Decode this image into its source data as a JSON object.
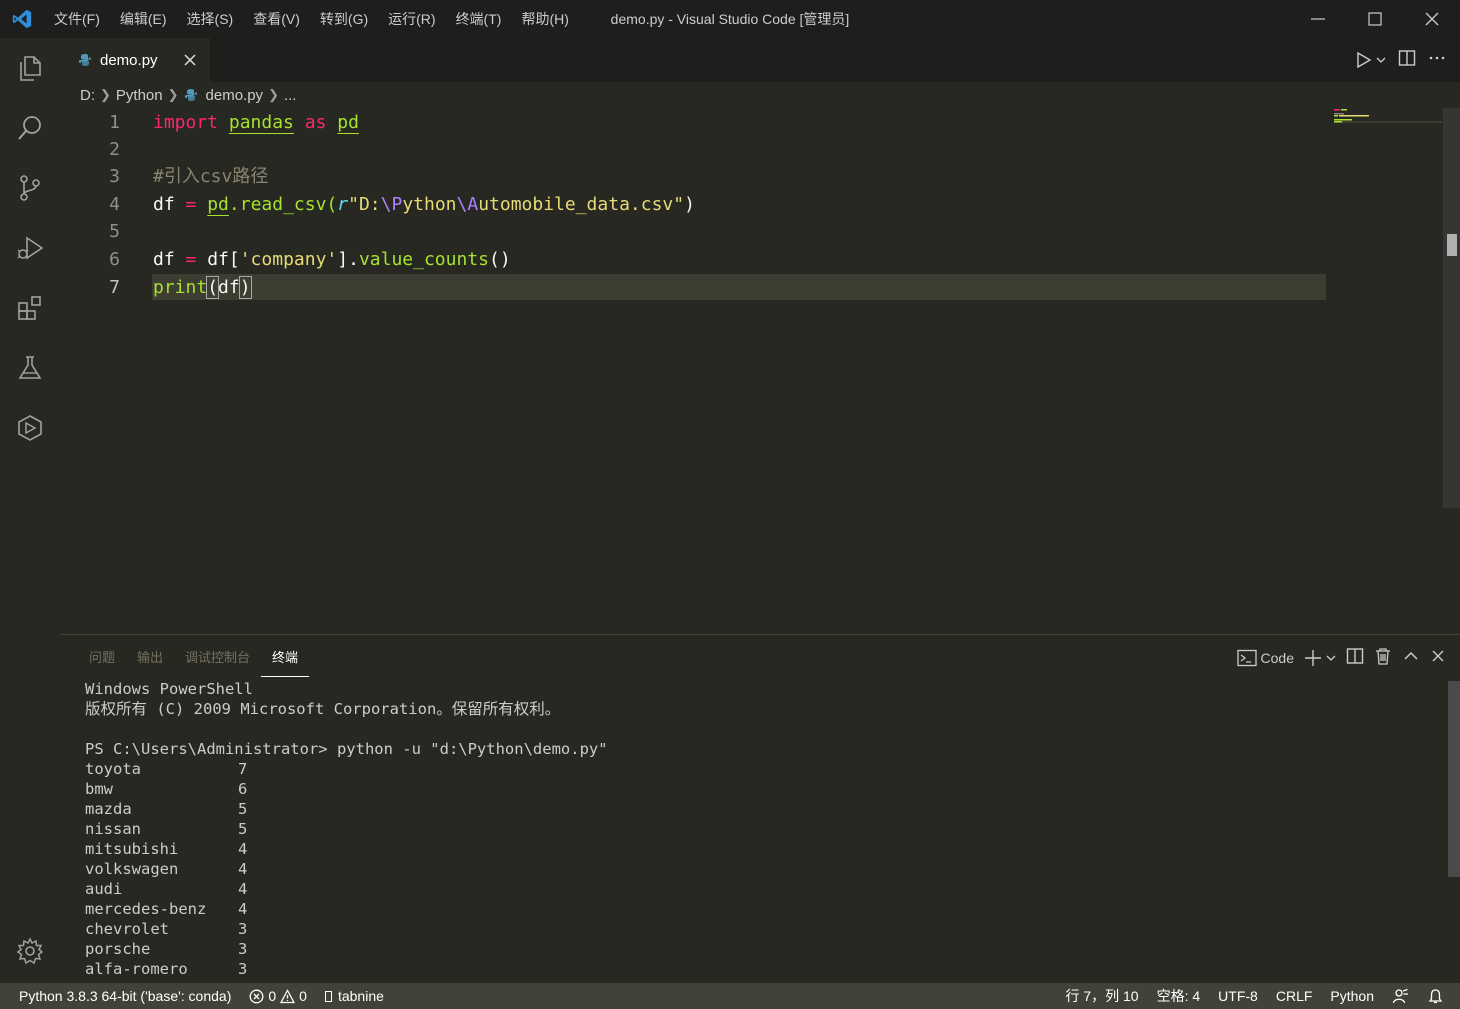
{
  "window": {
    "title": "demo.py - Visual Studio Code [管理员]"
  },
  "menu": [
    "文件(F)",
    "编辑(E)",
    "选择(S)",
    "查看(V)",
    "转到(G)",
    "运行(R)",
    "终端(T)",
    "帮助(H)"
  ],
  "tab": {
    "label": "demo.py"
  },
  "breadcrumb": {
    "drive": "D:",
    "folder": "Python",
    "file": "demo.py",
    "more": "..."
  },
  "editor": {
    "line_numbers": [
      "1",
      "2",
      "3",
      "4",
      "5",
      "6",
      "7"
    ],
    "code": {
      "l1": {
        "import": "import",
        "pandas": "pandas",
        "as": "as",
        "pd": "pd"
      },
      "l3": "#引入csv路径",
      "l4": {
        "df": "df",
        "eq": " = ",
        "pd": "pd",
        "call": ".read_csv(",
        "r": "r",
        "q1": "\"D:",
        "e1": "\\P",
        "p1": "ython",
        "e2": "\\A",
        "p2": "utomobile_data.csv\"",
        "close": ")"
      },
      "l6": {
        "df": "df",
        "eq": " = ",
        "df2": "df[",
        "str": "'company'",
        "rest1": "].",
        "fn": "value_counts",
        "rest2": "()"
      },
      "l7": {
        "fn": "print",
        "open": "(",
        "arg": "df",
        "close": ")"
      }
    }
  },
  "panel": {
    "tabs": [
      "问题",
      "输出",
      "调试控制台",
      "终端"
    ],
    "active_tab": "终端",
    "terminal_name": "Code",
    "terminal": {
      "header1": "Windows PowerShell",
      "header2": "版权所有 (C) 2009 Microsoft Corporation。保留所有权利。",
      "prompt": "PS C:\\Users\\Administrator> python -u \"d:\\Python\\demo.py\"",
      "results": [
        {
          "name": "toyota",
          "count": "7"
        },
        {
          "name": "bmw",
          "count": "6"
        },
        {
          "name": "mazda",
          "count": "5"
        },
        {
          "name": "nissan",
          "count": "5"
        },
        {
          "name": "mitsubishi",
          "count": "4"
        },
        {
          "name": "volkswagen",
          "count": "4"
        },
        {
          "name": "audi",
          "count": "4"
        },
        {
          "name": "mercedes-benz",
          "count": "4"
        },
        {
          "name": "chevrolet",
          "count": "3"
        },
        {
          "name": "porsche",
          "count": "3"
        },
        {
          "name": "alfa-romero",
          "count": "3"
        }
      ]
    }
  },
  "statusbar": {
    "interpreter": "Python 3.8.3 64-bit ('base': conda)",
    "errors": "0",
    "warnings": "0",
    "tabnine": "tabnine",
    "position": "行 7，列 10",
    "spaces": "空格: 4",
    "encoding": "UTF-8",
    "eol": "CRLF",
    "language": "Python"
  },
  "colors": {
    "background": "#272822",
    "titlebar": "#1e1f1c",
    "statusbar": "#414339",
    "keyword": "#f92672",
    "function": "#a6e22e",
    "string": "#e6db74",
    "comment": "#88846f"
  },
  "icons": [
    "vscode-logo-icon",
    "explorer-icon",
    "search-icon",
    "source-control-icon",
    "run-debug-icon",
    "extensions-icon",
    "testing-icon",
    "remote-icon",
    "settings-gear-icon"
  ]
}
